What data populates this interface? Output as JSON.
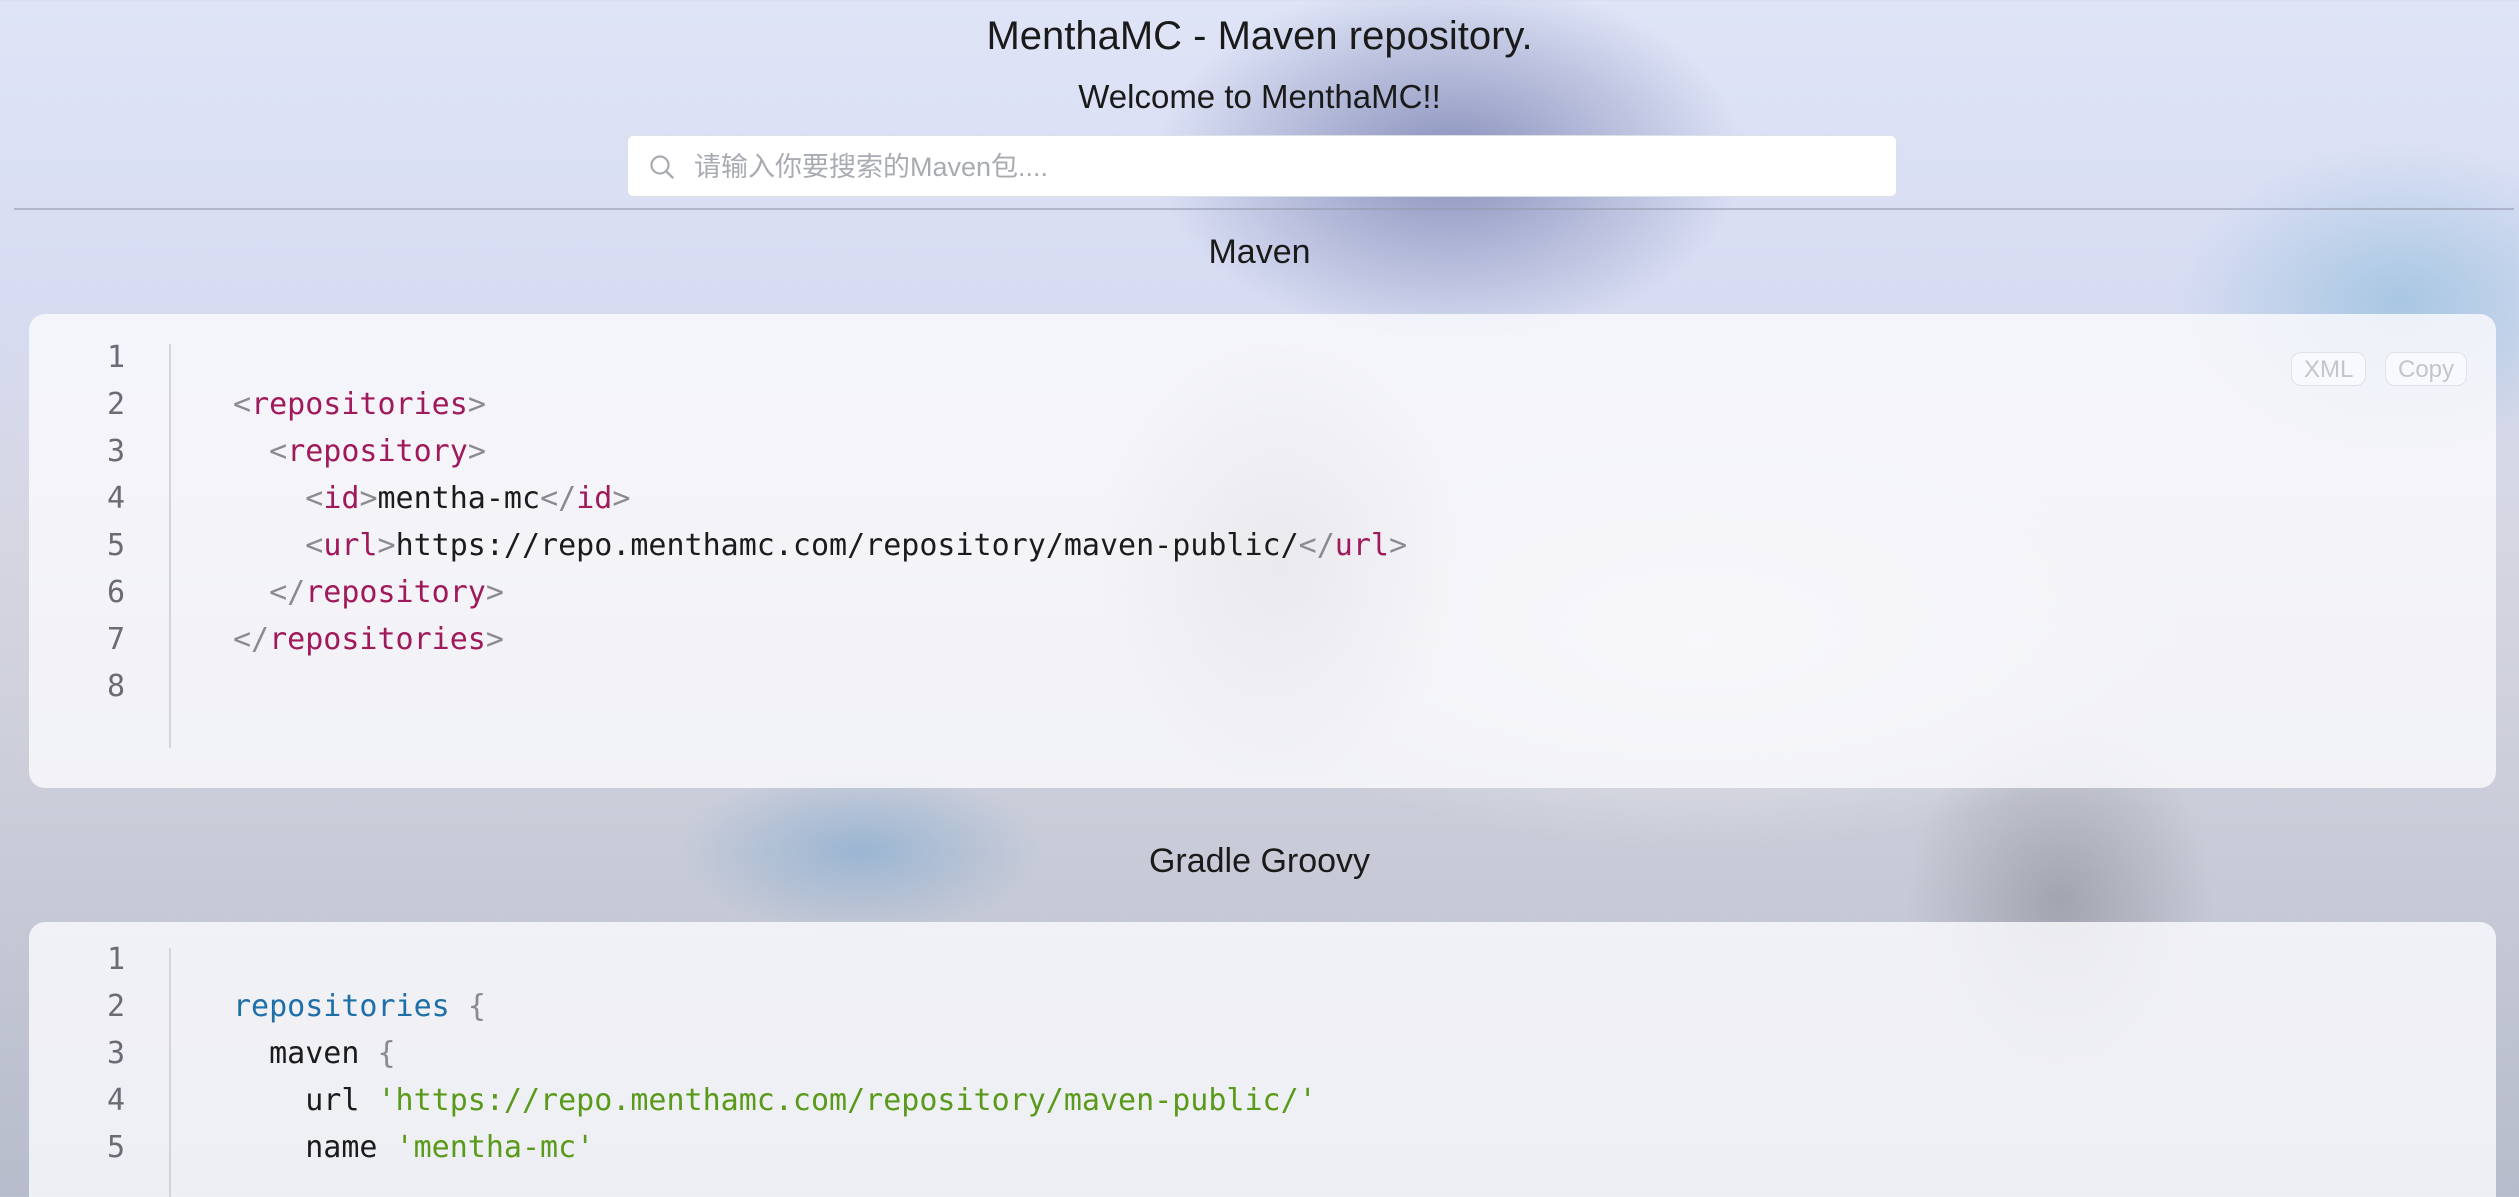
{
  "header": {
    "title": "MenthaMC - Maven repository.",
    "subtitle": "Welcome to MenthaMC!!"
  },
  "search": {
    "placeholder": "请输入你要搜索的Maven包....",
    "value": "",
    "icon": "search-icon"
  },
  "sections": [
    {
      "title": "Maven",
      "language_label": "XML",
      "copy_label": "Copy",
      "line_numbers": [
        "1",
        "2",
        "3",
        "4",
        "5",
        "6",
        "7",
        "8"
      ],
      "tokens": [
        {
          "open1": "<",
          "tag_repositories": "repositories",
          "close1": ">"
        },
        {
          "open": "<",
          "tag": "repository",
          "close": ">"
        },
        {
          "open": "<",
          "tag": "id",
          "close": ">",
          "text": "mentha-mc",
          "open_end": "</",
          "tag_end": "id",
          "close_end": ">"
        },
        {
          "open": "<",
          "tag": "url",
          "close": ">",
          "text": "https://repo.menthamc.com/repository/maven-public/",
          "open_end": "</",
          "tag_end": "url",
          "close_end": ">"
        },
        {
          "open_end": "</",
          "tag_end": "repository",
          "close_end": ">"
        },
        {
          "open_end": "</",
          "tag_end": "repositories",
          "close_end": ">"
        }
      ]
    },
    {
      "title": "Gradle Groovy",
      "line_numbers": [
        "1",
        "2",
        "3",
        "4",
        "5"
      ],
      "tokens": {
        "repositories_kw": "repositories",
        "brace_open": "{",
        "maven_kw": "maven",
        "url_kw": "url",
        "url_val": "'https://repo.menthamc.com/repository/maven-public/'",
        "name_kw": "name",
        "name_val": "'mentha-mc'"
      }
    }
  ]
}
